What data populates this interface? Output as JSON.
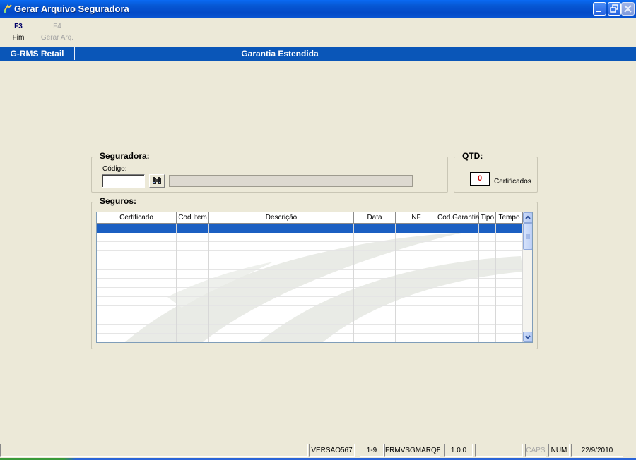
{
  "window": {
    "title": "Gerar Arquivo Seguradora"
  },
  "toolbar": {
    "items": [
      {
        "key": "F3",
        "label": "Fim",
        "enabled": true
      },
      {
        "key": "F4",
        "label": "Gerar Arq.",
        "enabled": false
      }
    ]
  },
  "header": {
    "app_name": "G-RMS Retail",
    "module": "Garantia Estendida"
  },
  "seguradora": {
    "title": "Seguradora:",
    "codigo_label": "Código:",
    "codigo_value": "",
    "name_value": ""
  },
  "qtd": {
    "title": "QTD:",
    "value": "0",
    "unit_label": "Certificados"
  },
  "seguros": {
    "title": "Seguros:",
    "columns": [
      "Certificado",
      "Cod Item",
      "Descrição",
      "Data",
      "NF",
      "Cod.Garantia",
      "Tipo",
      "Tempo"
    ],
    "rows": []
  },
  "statusbar": {
    "version": "VERSAO567",
    "page": "1-9",
    "form": "FRMVSGMARQE",
    "release": "1.0.0",
    "caps": "CAPS",
    "num": "NUM",
    "date": "22/9/2010"
  },
  "colors": {
    "titlebar": "#0a57d4",
    "header": "#0a56b8",
    "selected_row": "#1b5fc2",
    "qtd_value": "#cc0000",
    "background": "#ece9d8"
  }
}
